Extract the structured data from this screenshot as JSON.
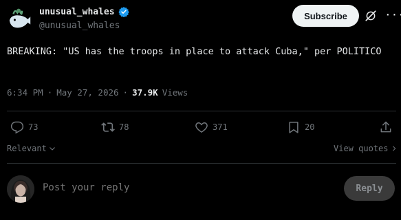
{
  "author": {
    "name": "unusual_whales",
    "handle": "@unusual_whales",
    "subscribe_label": "Subscribe"
  },
  "tweet": {
    "text": "BREAKING: \"US has the troops in place to attack Cuba,\" per POLITICO",
    "time": "6:34 PM",
    "date": "May 27, 2026",
    "views_count": "37.9K",
    "views_label": "Views"
  },
  "actions": {
    "replies": "73",
    "reposts": "78",
    "likes": "371",
    "bookmarks": "20"
  },
  "sort": {
    "label": "Relevant"
  },
  "quotes": {
    "label": "View quotes"
  },
  "reply": {
    "placeholder": "Post your reply",
    "button_label": "Reply"
  },
  "colors": {
    "background": "#000000",
    "text": "#e7e9ea",
    "muted": "#71767b",
    "verified": "#1d9bf0",
    "divider": "#2f3336"
  },
  "icons": [
    "whale-avatar",
    "verified-badge-icon",
    "grok-icon",
    "more-icon",
    "reply-icon",
    "repost-icon",
    "like-icon",
    "bookmark-icon",
    "share-icon",
    "chevron-down-icon",
    "chevron-right-icon"
  ]
}
